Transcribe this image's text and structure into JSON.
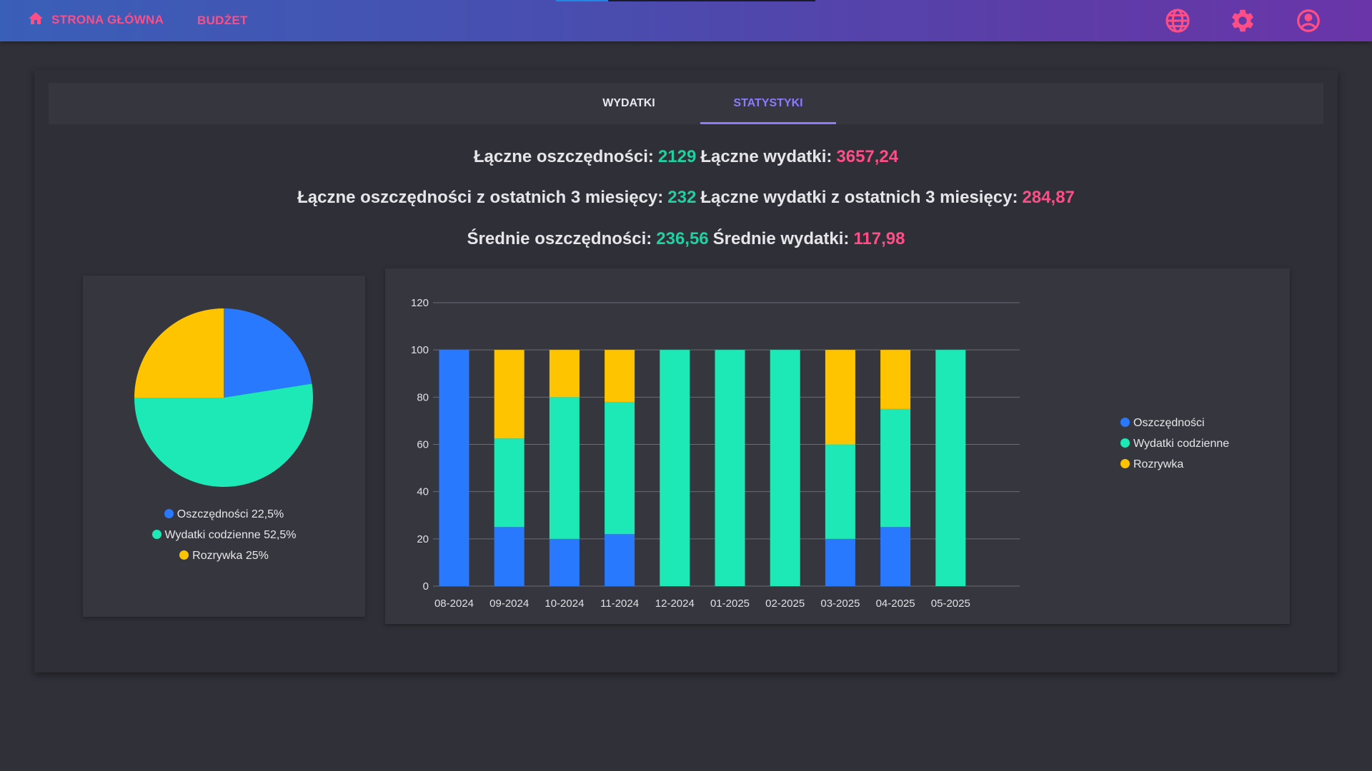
{
  "nav": {
    "home_label": "STRONA GŁÓWNA",
    "budget_label": "BUDŻET",
    "home_icon": "home-icon",
    "language_icon": "globe-icon",
    "settings_icon": "gear-icon",
    "account_icon": "account-circle-icon",
    "accent_color": "#ff4d86"
  },
  "tabs": [
    {
      "label": "WYDATKI",
      "active": false
    },
    {
      "label": "STATYSTYKI",
      "active": true
    }
  ],
  "stats": {
    "total_savings_label": "Łączne oszczędności:",
    "total_savings_value": "2129",
    "total_expenses_label": "Łączne wydatki:",
    "total_expenses_value": "3657,24",
    "savings_3m_label": "Łączne oszczędności z ostatnich 3 miesięcy:",
    "savings_3m_value": "232",
    "expenses_3m_label": "Łączne wydatki z ostatnich 3 miesięcy:",
    "expenses_3m_value": "284,87",
    "avg_savings_label": "Średnie oszczędności:",
    "avg_savings_value": "236,56",
    "avg_expenses_label": "Średnie wydatki:",
    "avg_expenses_value": "117,98"
  },
  "colors": {
    "savings": "#2979ff",
    "daily": "#1de9b6",
    "fun": "#ffc400",
    "green_text": "#1fd0a1",
    "pink_text": "#ff4d86"
  },
  "chart_data": [
    {
      "type": "pie",
      "labels": [
        "Oszczędności",
        "Wydatki codzienne",
        "Rozrywka"
      ],
      "values": [
        22.5,
        52.5,
        25
      ],
      "legend": [
        "Oszczędności 22,5%",
        "Wydatki codzienne 52,5%",
        "Rozrywka 25%"
      ]
    },
    {
      "type": "bar",
      "stacked": true,
      "categories": [
        "08-2024",
        "09-2024",
        "10-2024",
        "11-2024",
        "12-2024",
        "01-2025",
        "02-2025",
        "03-2025",
        "04-2025",
        "05-2025"
      ],
      "series": [
        {
          "name": "Oszczędności",
          "values": [
            100,
            25,
            20,
            22,
            0,
            0,
            0,
            20,
            25,
            0
          ]
        },
        {
          "name": "Wydatki codzienne",
          "values": [
            0,
            37.5,
            60,
            56,
            100,
            100,
            100,
            40,
            50,
            100
          ]
        },
        {
          "name": "Rozrywka",
          "values": [
            0,
            37.5,
            20,
            22,
            0,
            0,
            0,
            40,
            25,
            0
          ]
        }
      ],
      "yticks": [
        "0",
        "20",
        "40",
        "60",
        "80",
        "100",
        "120"
      ],
      "ylim": [
        0,
        120
      ],
      "legend_position": "right",
      "grid": true
    }
  ]
}
